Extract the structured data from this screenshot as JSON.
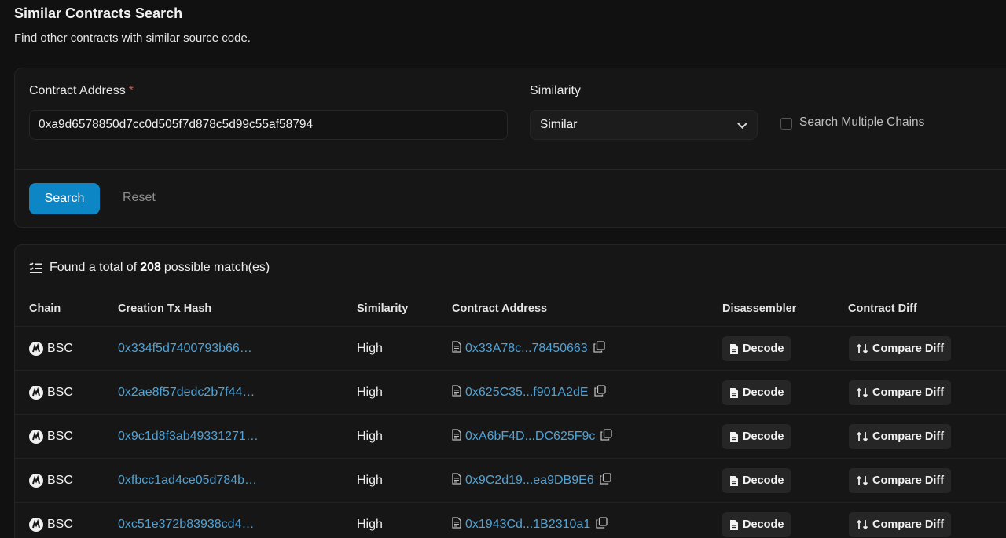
{
  "page": {
    "title": "Similar Contracts Search",
    "subtitle": "Find other contracts with similar source code."
  },
  "search_form": {
    "address_label": "Contract Address",
    "required_mark": "*",
    "address_value": "0xa9d6578850d7cc0d505f7d878c5d99c55af58794",
    "similarity_label": "Similarity",
    "similarity_value": "Similar",
    "multi_chain_label": "Search Multiple Chains",
    "multi_chain_checked": false,
    "search_button": "Search",
    "reset_button": "Reset"
  },
  "results": {
    "prefix": "Found a total of",
    "count": "208",
    "suffix": "possible match(es)",
    "columns": {
      "chain": "Chain",
      "tx_hash": "Creation Tx Hash",
      "similarity": "Similarity",
      "address": "Contract Address",
      "disassembler": "Disassembler",
      "diff": "Contract Diff"
    },
    "rows": [
      {
        "chain": "BSC",
        "tx_hash": "0x334f5d7400793b66…",
        "similarity": "High",
        "address": "0x33A78c...78450663",
        "decode": "Decode",
        "diff": "Compare Diff"
      },
      {
        "chain": "BSC",
        "tx_hash": "0x2ae8f57dedc2b7f44…",
        "similarity": "High",
        "address": "0x625C35...f901A2dE",
        "decode": "Decode",
        "diff": "Compare Diff"
      },
      {
        "chain": "BSC",
        "tx_hash": "0x9c1d8f3ab49331271…",
        "similarity": "High",
        "address": "0xA6bF4D...DC625F9c",
        "decode": "Decode",
        "diff": "Compare Diff"
      },
      {
        "chain": "BSC",
        "tx_hash": "0xfbcc1ad4ce05d784b…",
        "similarity": "High",
        "address": "0x9C2d19...ea9DB9E6",
        "decode": "Decode",
        "diff": "Compare Diff"
      },
      {
        "chain": "BSC",
        "tx_hash": "0xc51e372b83938cd4…",
        "similarity": "High",
        "address": "0x1943Cd...1B2310a1",
        "decode": "Decode",
        "diff": "Compare Diff"
      }
    ]
  },
  "colors": {
    "background": "#111111",
    "accent": "#0d86c6",
    "link": "#4fa3d6",
    "required": "#e24c4c"
  }
}
